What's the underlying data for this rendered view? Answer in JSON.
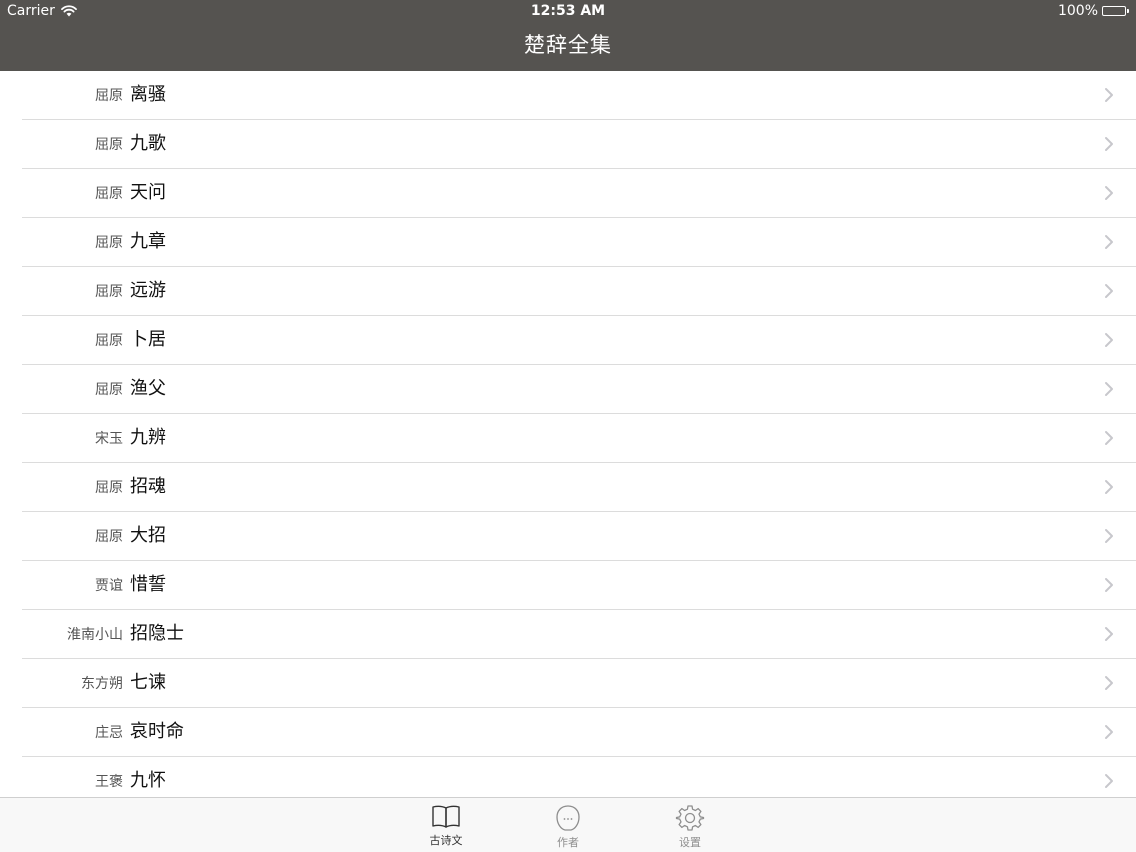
{
  "status_bar": {
    "carrier": "Carrier",
    "time": "12:53 AM",
    "battery": "100%"
  },
  "nav": {
    "title": "楚辞全集"
  },
  "list": [
    {
      "author": "屈原",
      "title": "离骚"
    },
    {
      "author": "屈原",
      "title": "九歌"
    },
    {
      "author": "屈原",
      "title": "天问"
    },
    {
      "author": "屈原",
      "title": "九章"
    },
    {
      "author": "屈原",
      "title": "远游"
    },
    {
      "author": "屈原",
      "title": "卜居"
    },
    {
      "author": "屈原",
      "title": "渔父"
    },
    {
      "author": "宋玉",
      "title": "九辨"
    },
    {
      "author": "屈原",
      "title": "招魂"
    },
    {
      "author": "屈原",
      "title": "大招"
    },
    {
      "author": "贾谊",
      "title": "惜誓"
    },
    {
      "author": "淮南小山",
      "title": "招隐士"
    },
    {
      "author": "东方朔",
      "title": "七谏"
    },
    {
      "author": "庄忌",
      "title": "哀时命"
    },
    {
      "author": "王褒",
      "title": "九怀"
    }
  ],
  "tabs": [
    {
      "label": "古诗文",
      "icon": "book-icon",
      "active": true
    },
    {
      "label": "作者",
      "icon": "person-icon",
      "active": false
    },
    {
      "label": "设置",
      "icon": "gear-icon",
      "active": false
    }
  ],
  "colors": {
    "header_bg": "#555350",
    "separator": "#dcdcdc",
    "tab_active": "#333333",
    "tab_inactive": "#8e8e8e"
  }
}
